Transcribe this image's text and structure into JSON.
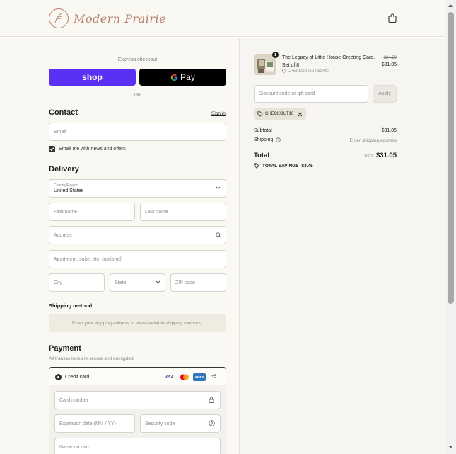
{
  "header": {
    "logo_text": "Modern Prairie",
    "cart_icon": "shopping-bag-icon"
  },
  "express": {
    "label": "Express checkout",
    "shop_label": "shop",
    "gpay_label": "Pay",
    "or_label": "OR"
  },
  "contact": {
    "title": "Contact",
    "sign_in": "Sign in",
    "email_placeholder": "Email",
    "newsletter_label": "Email me with news and offers",
    "newsletter_checked": true
  },
  "delivery": {
    "title": "Delivery",
    "country_label": "Country/Region",
    "country_value": "United States",
    "first_name": "First name",
    "last_name": "Last name",
    "address": "Address",
    "apartment": "Apartment, suite, etc. (optional)",
    "city": "City",
    "state": "State",
    "zip": "ZIP code"
  },
  "shipping": {
    "title": "Shipping method",
    "message": "Enter your shipping address to view available shipping methods."
  },
  "payment": {
    "title": "Payment",
    "subtitle": "All transactions are secure and encrypted.",
    "method_label": "Credit card",
    "cards": [
      "VISA",
      "MC",
      "AMEX",
      "+5"
    ],
    "card_number": "Card number",
    "expiration": "Expiration date (MM / YY)",
    "security_code": "Security code",
    "name_on_card": "Name on card"
  },
  "order": {
    "quantity": "1",
    "product_name": "The Legacy of Little House Greeting Card, Set of 8",
    "discount_code_small": "CHECKOUT10 (-$3.45)",
    "original_price": "$34.50",
    "price": "$31.05",
    "discount_placeholder": "Discount code or gift card",
    "apply_label": "Apply",
    "applied_code": "CHECKOUT10",
    "subtotal_label": "Subtotal",
    "subtotal_value": "$31.05",
    "shipping_label": "Shipping",
    "shipping_value": "Enter shipping address",
    "total_label": "Total",
    "currency": "USD",
    "total_value": "$31.05",
    "savings_label": "TOTAL SAVINGS",
    "savings_value": "$3.45"
  },
  "colors": {
    "shop_purple": "#5a31f4",
    "gpay_black": "#000000",
    "logo_accent": "#b7806a",
    "panel_bg": "#faf8f3"
  }
}
